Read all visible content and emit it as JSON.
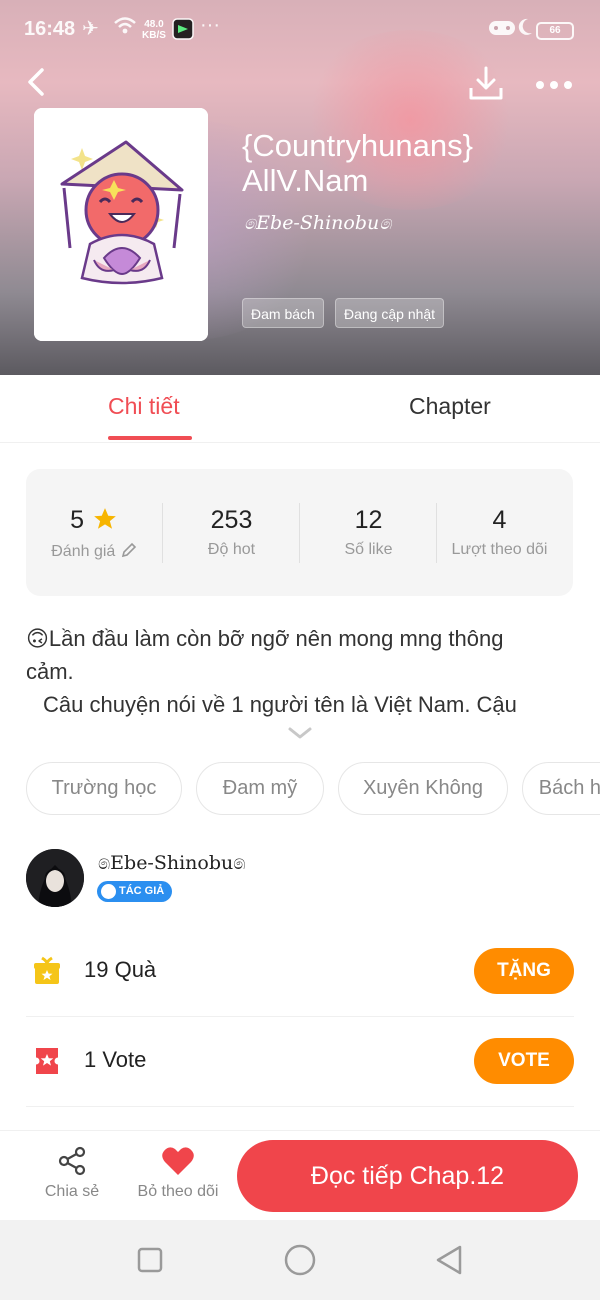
{
  "status_bar": {
    "time": "16:48",
    "net_speed_value": "48.0",
    "net_speed_unit": "KB/S",
    "battery": "66",
    "icons": [
      "airplane-icon",
      "wifi-icon",
      "app-notification-icon",
      "more-notifications-icon",
      "game-mode-icon",
      "moon-icon",
      "battery-icon"
    ]
  },
  "header": {
    "title": "{Countryhunans} AllV.Nam",
    "author_signature": "෧Ebe-Shinobu෧",
    "tags": [
      "Đam bách",
      "Đang cập nhật"
    ],
    "icons": [
      "back-icon",
      "download-icon",
      "more-icon"
    ]
  },
  "tabs": {
    "items": [
      "Chi tiết",
      "Chapter"
    ],
    "active": "Chi tiết"
  },
  "stats": [
    {
      "value": "5",
      "label": "Đánh giá",
      "icons": [
        "star-icon",
        "edit-icon"
      ]
    },
    {
      "value": "253",
      "label": "Độ hot"
    },
    {
      "value": "12",
      "label": "Số like"
    },
    {
      "value": "4",
      "label": "Lượt theo dõi"
    }
  ],
  "description": {
    "line1": "🙃Lần đầu làm còn bỡ ngỡ nên mong mng thông",
    "line2": "cảm.",
    "line3": "Câu chuyện nói về 1 người tên là Việt Nam. Cậu"
  },
  "genres": [
    "Trường học",
    "Đam mỹ",
    "Xuyên Không",
    "Bách hợp"
  ],
  "author": {
    "name": "෧Ebe-Shinobu෧",
    "badge": "TÁC GIẢ"
  },
  "gifts": {
    "text": "19 Quà",
    "button": "TẶNG",
    "icon": "gift-icon"
  },
  "votes": {
    "text": "1 Vote",
    "button": "VOTE",
    "icon": "ticket-icon"
  },
  "action_bar": {
    "share_label": "Chia sẻ",
    "unfollow_label": "Bỏ theo dõi",
    "read_label": "Đọc tiếp Chap.12"
  },
  "colors": {
    "accent_red": "#f04d54",
    "orange": "#ff8c00",
    "badge_blue": "#2b8ff0",
    "gift_yellow": "#f5c518"
  }
}
